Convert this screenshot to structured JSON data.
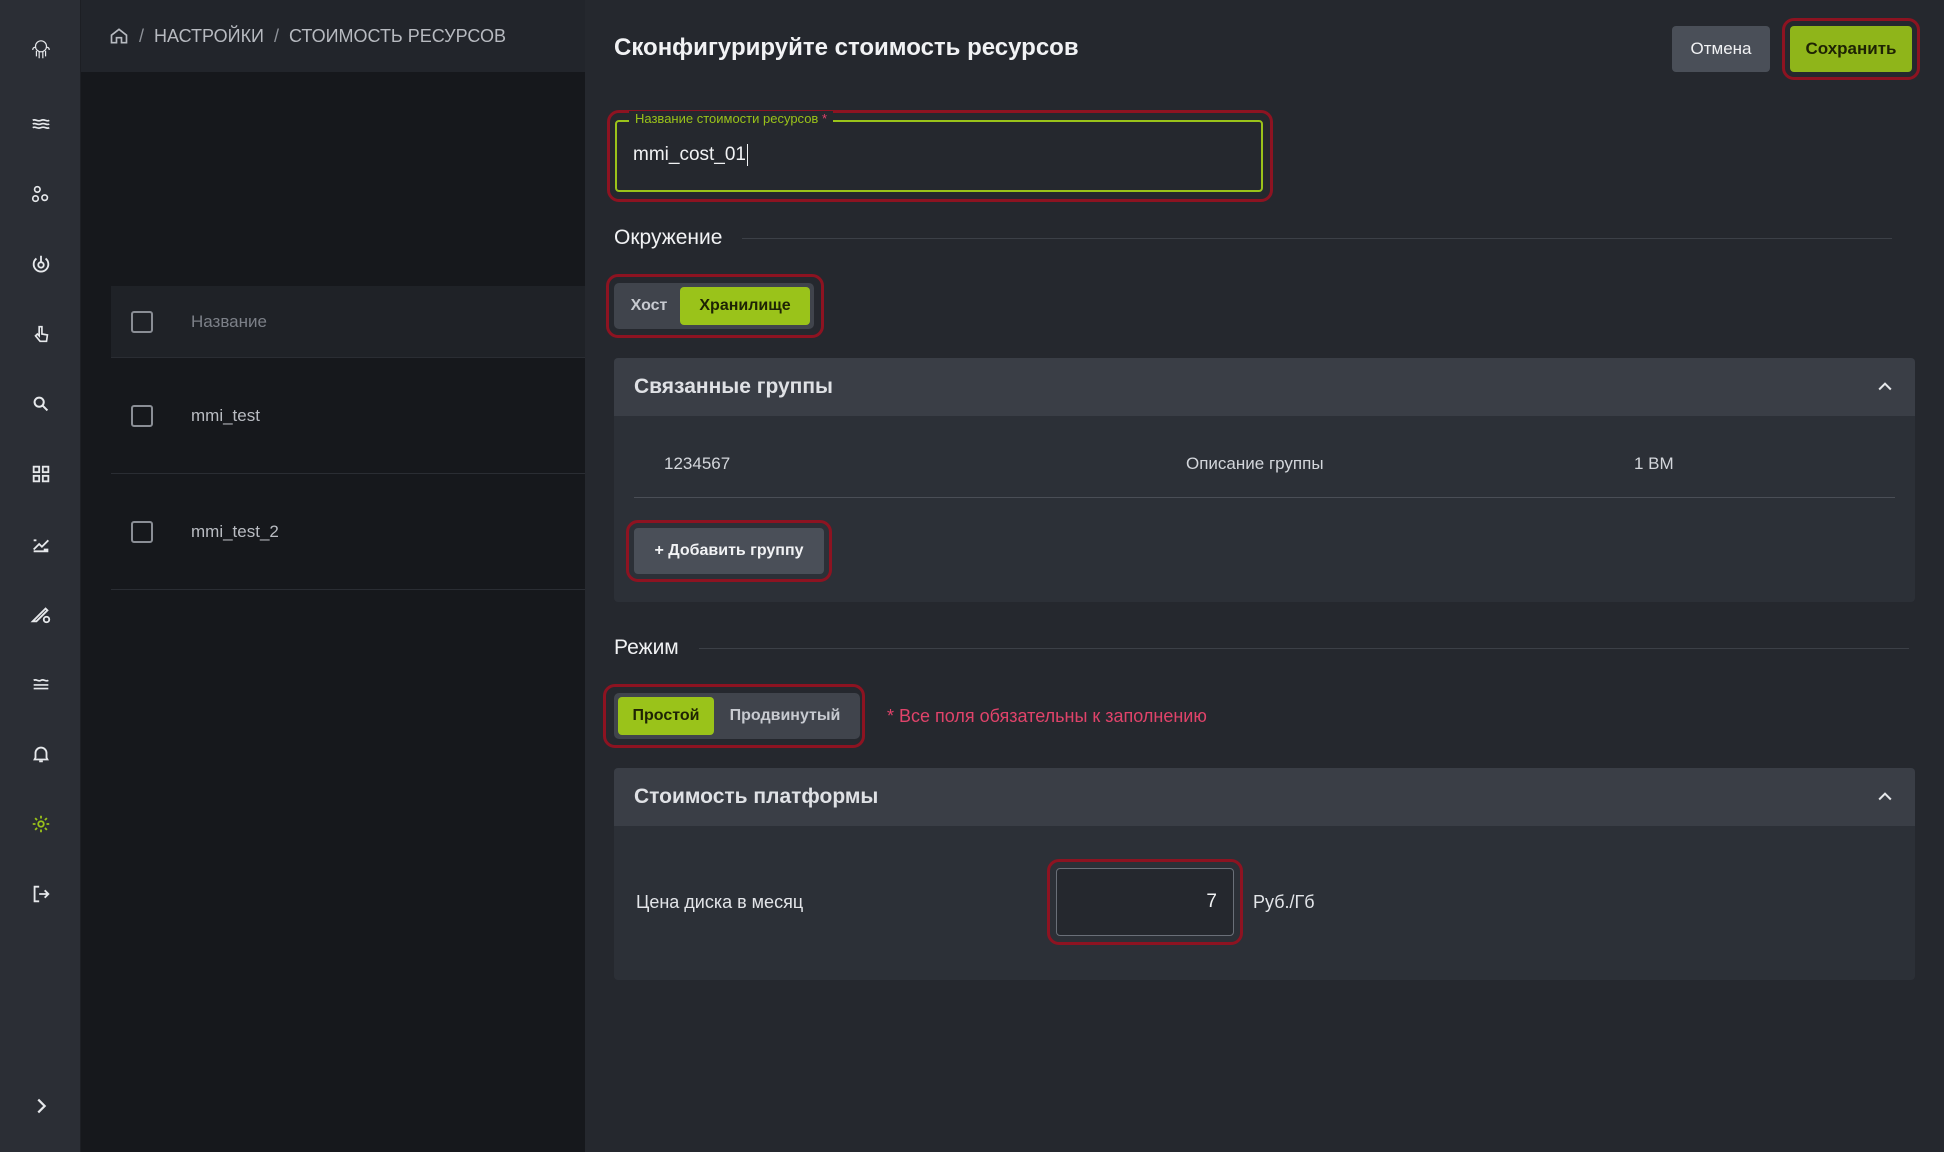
{
  "breadcrumb": {
    "items": [
      "НАСТРОЙКИ",
      "СТОИМОСТЬ РЕСУРСОВ"
    ],
    "separator": "/"
  },
  "list": {
    "column_header": "Название",
    "rows": [
      {
        "name": "mmi_test"
      },
      {
        "name": "mmi_test_2"
      }
    ]
  },
  "panel": {
    "title": "Сконфигурируйте стоимость ресурсов",
    "cancel_label": "Отмена",
    "save_label": "Сохранить",
    "name_field": {
      "label": "Название стоимости ресурсов",
      "required_mark": "*",
      "value": "mmi_cost_01"
    },
    "environment": {
      "section_title": "Окружение",
      "options": [
        "Хост",
        "Хранилище"
      ],
      "selected": "Хранилище"
    },
    "linked_groups": {
      "title": "Связанные группы",
      "rows": [
        {
          "id": "1234567",
          "description": "Описание группы",
          "count": "1 ВМ"
        }
      ],
      "add_label": "+ Добавить группу"
    },
    "mode": {
      "section_title": "Режим",
      "options": [
        "Простой",
        "Продвинутый"
      ],
      "selected": "Простой",
      "required_note": "* Все поля обязательны к заполнению"
    },
    "platform_cost": {
      "title": "Стоимость платформы",
      "disk_price_label": "Цена диска в месяц",
      "disk_price_value": "7",
      "unit": "Руб./Гб"
    }
  },
  "colors": {
    "accent": "#9ac31a",
    "danger": "#e0436a",
    "highlight": "#8d1321"
  }
}
